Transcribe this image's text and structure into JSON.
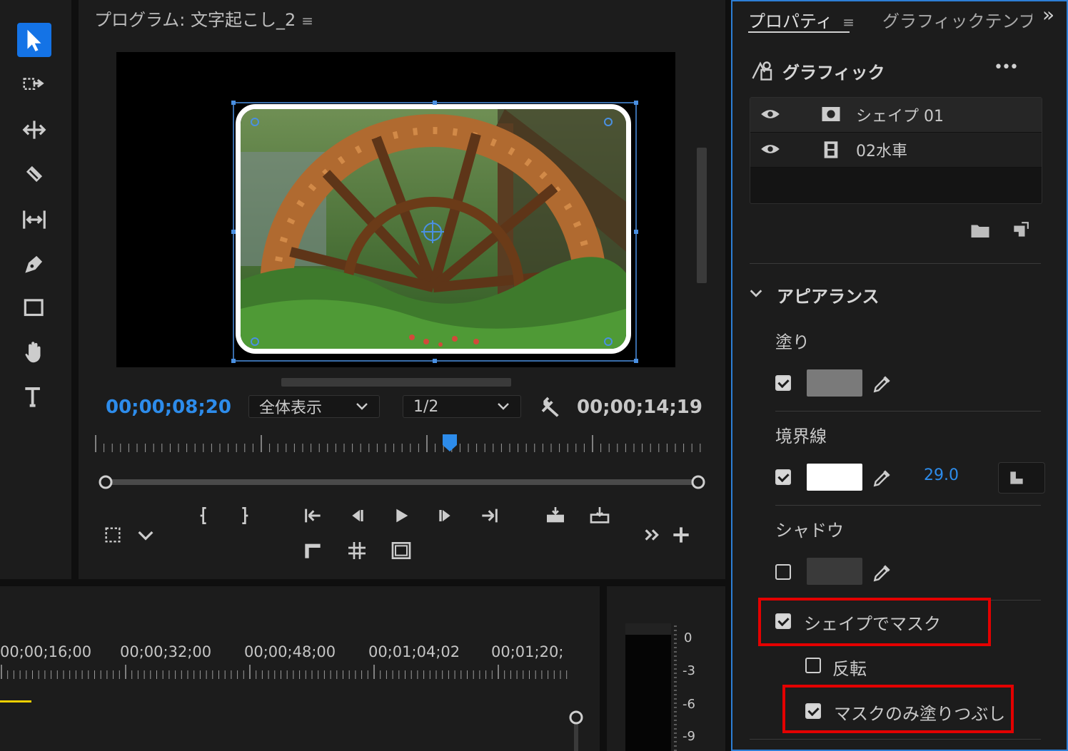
{
  "toolbar": {
    "tools": [
      {
        "icon": "selection-arrow-icon",
        "active": true
      },
      {
        "icon": "track-select-icon",
        "active": false
      },
      {
        "icon": "ripple-edit-icon",
        "active": false
      },
      {
        "icon": "razor-icon",
        "active": false
      },
      {
        "icon": "slip-icon",
        "active": false
      },
      {
        "icon": "pen-icon",
        "active": false
      },
      {
        "icon": "rectangle-icon",
        "active": false
      },
      {
        "icon": "hand-icon",
        "active": false
      },
      {
        "icon": "type-icon",
        "active": false
      }
    ]
  },
  "monitor": {
    "title": "プログラム: 文字起こし_2",
    "menu_glyph": "≡",
    "current_timecode": "00;00;08;20",
    "zoom_select": "全体表示",
    "resolution_select": "1/2",
    "duration_timecode": "00;00;14;19",
    "playhead_fraction": 0.585
  },
  "timeline": {
    "timecodes": [
      "00;00;16;00",
      "00;00;32;00",
      "00;00;48;00",
      "00;01;04;02",
      "00;01;20;"
    ],
    "meter_labels": [
      "0",
      "-3",
      "-6",
      "-9"
    ]
  },
  "panel": {
    "tabs": [
      {
        "label": "プロパティ",
        "active": true,
        "menu": "≡"
      },
      {
        "label": "グラフィックテンプ",
        "active": false
      }
    ],
    "overflow_glyph": "»",
    "graphic_title": "グラフィック",
    "more_glyph": "•••",
    "layers": [
      {
        "name": "シェイプ 01",
        "icon": "shape-layer-icon"
      },
      {
        "name": "02水車",
        "icon": "film-layer-icon"
      }
    ],
    "appearance_title": "アピアランス",
    "fill": {
      "label": "塗り",
      "checked": true,
      "color": "#7a7a7a"
    },
    "stroke": {
      "label": "境界線",
      "checked": true,
      "color": "#ffffff",
      "width": "29.0"
    },
    "shadow": {
      "label": "シャドウ",
      "checked": false,
      "color": "#3a3a3a"
    },
    "mask_with_shape": {
      "label": "シェイプでマスク",
      "checked": true
    },
    "invert": {
      "label": "反転",
      "checked": false
    },
    "fill_mask_only": {
      "label": "マスクのみ塗りつぶし",
      "checked": true
    },
    "colors": {
      "accent": "#2d8ceb",
      "highlight": "#e30000",
      "panel_border": "#2d7fd6"
    }
  }
}
